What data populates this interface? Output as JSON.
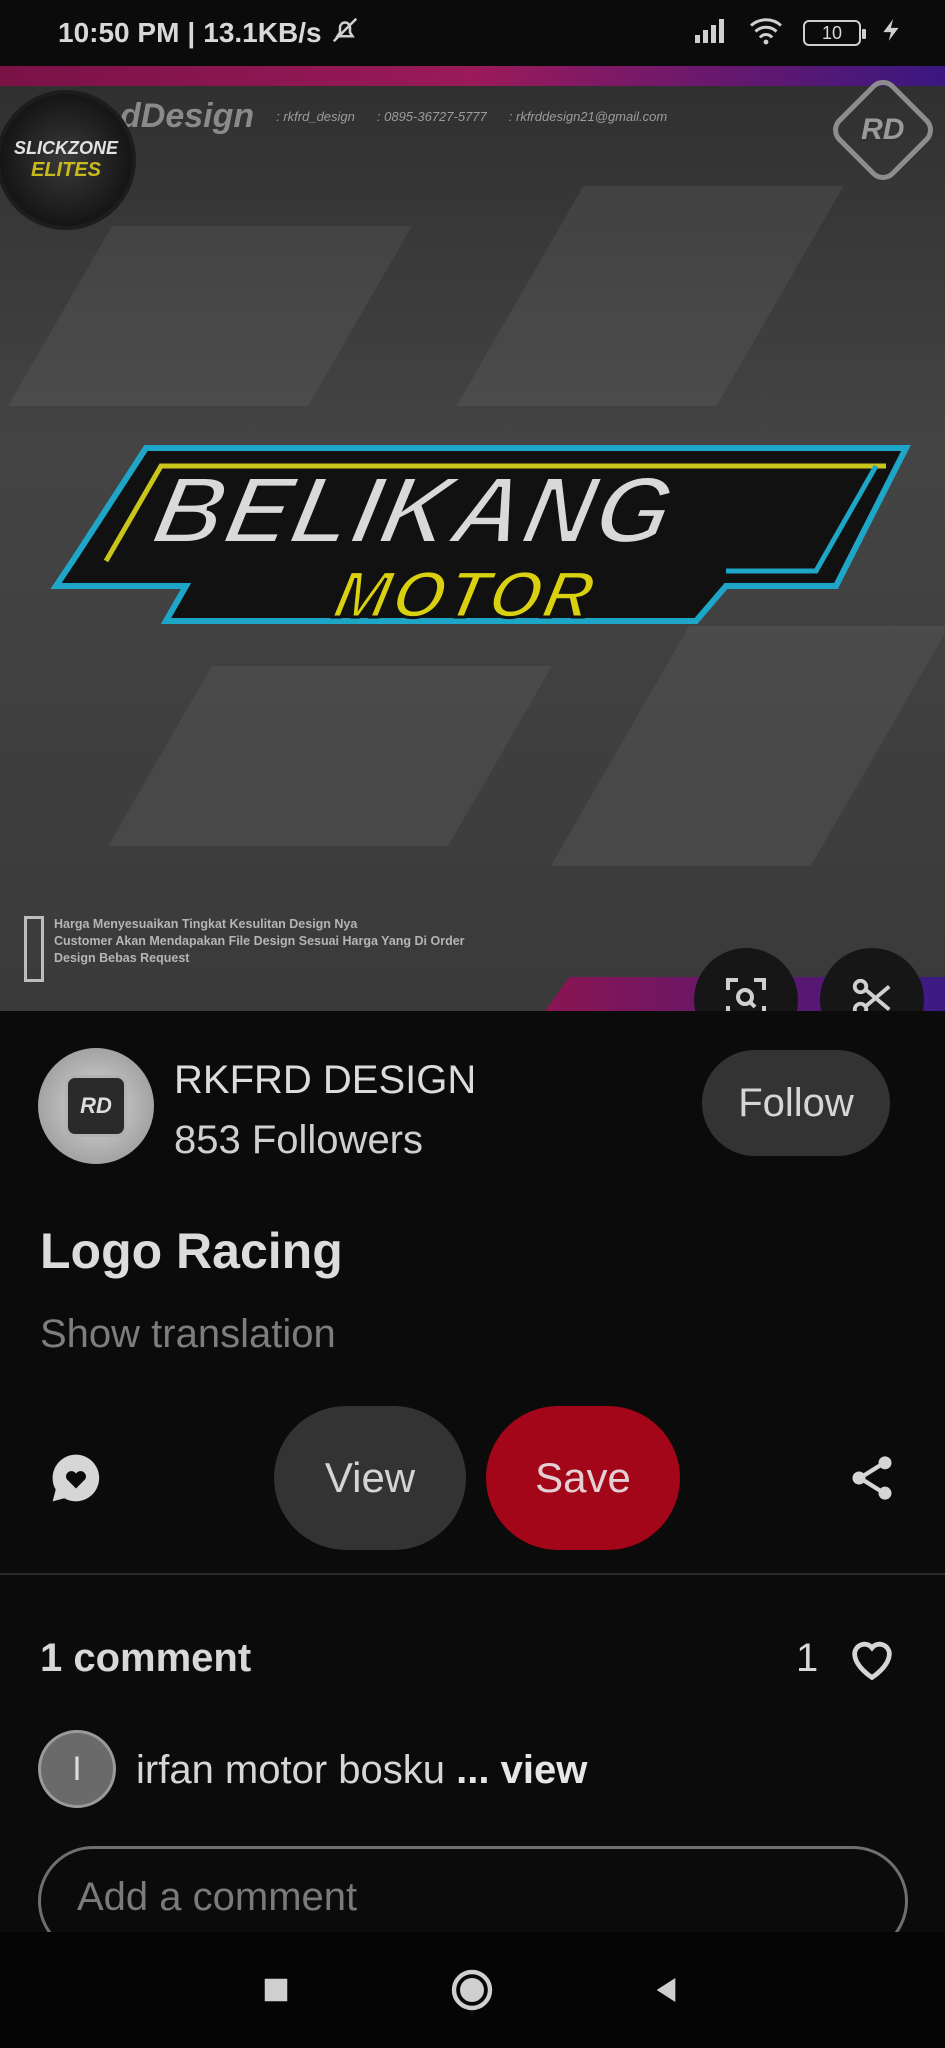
{
  "status_bar": {
    "time": "10:50 PM",
    "separator": "|",
    "speed": "13.1KB/s",
    "battery": "10"
  },
  "hero": {
    "brand_script": "dDesign",
    "instagram": ": rkfrd_design",
    "phone": ": 0895-36727-5777",
    "email": ": rkfrddesign21@gmail.com",
    "badge_top": "SLICKZONE",
    "badge_bottom": "ELITES",
    "rd_logo": "RD",
    "logo_title": "BELIKANG",
    "logo_sub": "MOTOR",
    "note_1": "Harga Menyesuaikan Tingkat Kesulitan Design Nya",
    "note_2": "Customer Akan Mendapakan File Design Sesuai Harga Yang Di Order",
    "note_3": "Design Bebas Request"
  },
  "profile": {
    "avatar_text": "RD",
    "name": "RKFRD DESIGN",
    "followers": "853 Followers",
    "follow_label": "Follow"
  },
  "pin": {
    "title": "Logo Racing",
    "show_translation": "Show translation"
  },
  "actions": {
    "view_label": "View",
    "save_label": "Save"
  },
  "comments": {
    "count_label": "1 comment",
    "likes": "1",
    "items": [
      {
        "avatar_letter": "I",
        "text": "irfan motor bosku",
        "more": "... view"
      }
    ],
    "input_placeholder": "Add a comment"
  },
  "colors": {
    "save_red": "#a30618",
    "background": "#0b0b0b",
    "button_gray": "#333333"
  }
}
